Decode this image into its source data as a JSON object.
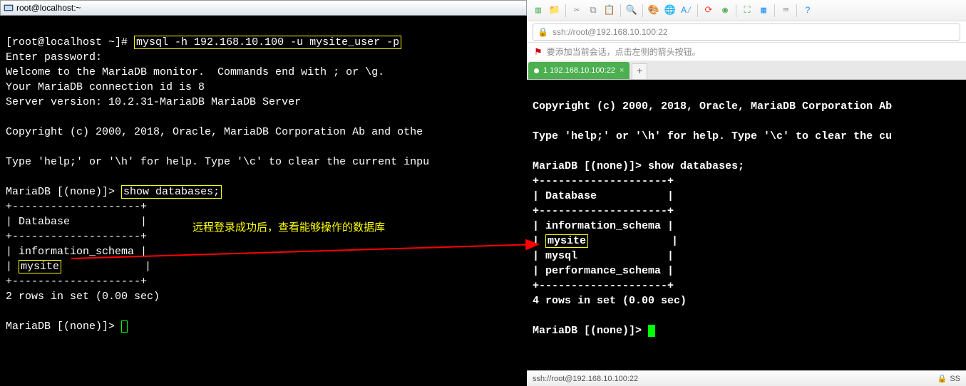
{
  "left": {
    "title": "root@localhost:~",
    "prompt": "[root@localhost ~]#",
    "command1": "mysql -h 192.168.10.100 -u mysite_user -p",
    "line_enter_pw": "Enter password:",
    "line_welcome": "Welcome to the MariaDB monitor.  Commands end with ; or \\g.",
    "line_conn": "Your MariaDB connection id is 8",
    "line_server": "Server version: 10.2.31-MariaDB MariaDB Server",
    "line_copyright": "Copyright (c) 2000, 2018, Oracle, MariaDB Corporation Ab and othe",
    "line_help": "Type 'help;' or '\\h' for help. Type '\\c' to clear the current inpu",
    "mariadb_prompt": "MariaDB [(none)]>",
    "command2": "show databases;",
    "tbl_border": "+--------------------+",
    "tbl_header": "| Database           |",
    "tbl_row1_pre": "| ",
    "tbl_row1_val": "information_schema",
    "tbl_row1_post": " |",
    "tbl_row2_pre": "| ",
    "tbl_row2_val": "mysite",
    "tbl_row2_post": "             |",
    "rows_msg": "2 rows in set (0.00 sec)",
    "annotation": "远程登录成功后，查看能够操作的数据库"
  },
  "right": {
    "address": "ssh://root@192.168.10.100:22",
    "infobar": "要添加当前会话，点击左侧的箭头按钮。",
    "tab_label": "1 192.168.10.100:22",
    "line_copyright": "Copyright (c) 2000, 2018, Oracle, MariaDB Corporation Ab",
    "line_help": "Type 'help;' or '\\h' for help. Type '\\c' to clear the cu",
    "mariadb_prompt": "MariaDB [(none)]>",
    "command": "show databases;",
    "tbl_border": "+--------------------+",
    "tbl_header": "| Database           |",
    "tbl_row1": "| information_schema |",
    "tbl_row2_pre": "| ",
    "tbl_row2_val": "mysite",
    "tbl_row2_post": "             |",
    "tbl_row3": "| mysql              |",
    "tbl_row4": "| performance_schema |",
    "rows_msg": "4 rows in set (0.00 sec)",
    "status_left": "ssh://root@192.168.10.100:22",
    "status_right": "SS"
  }
}
